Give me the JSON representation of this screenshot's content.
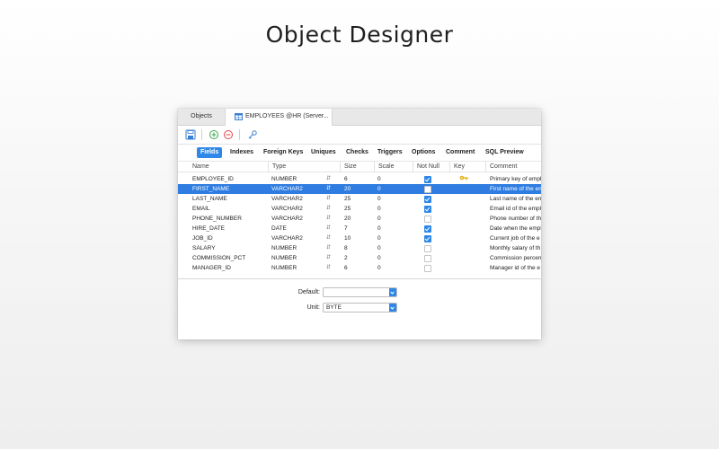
{
  "headline": "Object Designer",
  "tabs": {
    "objects": "Objects",
    "employees": "EMPLOYEES @HR (Server..."
  },
  "subtabs": [
    "Fields",
    "Indexes",
    "Foreign Keys",
    "Uniques",
    "Checks",
    "Triggers",
    "Options",
    "Comment",
    "SQL Preview"
  ],
  "active_subtab": "Fields",
  "columns": [
    "Name",
    "Type",
    "Size",
    "Scale",
    "Not Null",
    "Key",
    "Comment"
  ],
  "rows": [
    {
      "name": "EMPLOYEE_ID",
      "type": "NUMBER",
      "size": "6",
      "scale": "0",
      "not_null": true,
      "key": true,
      "comment": "Primary key of empl"
    },
    {
      "name": "FIRST_NAME",
      "type": "VARCHAR2",
      "size": "20",
      "scale": "0",
      "not_null": false,
      "key": false,
      "comment": "First name of the em"
    },
    {
      "name": "LAST_NAME",
      "type": "VARCHAR2",
      "size": "25",
      "scale": "0",
      "not_null": true,
      "key": false,
      "comment": "Last name of the em"
    },
    {
      "name": "EMAIL",
      "type": "VARCHAR2",
      "size": "25",
      "scale": "0",
      "not_null": true,
      "key": false,
      "comment": "Email id of the empl"
    },
    {
      "name": "PHONE_NUMBER",
      "type": "VARCHAR2",
      "size": "20",
      "scale": "0",
      "not_null": false,
      "key": false,
      "comment": "Phone number of th"
    },
    {
      "name": "HIRE_DATE",
      "type": "DATE",
      "size": "7",
      "scale": "0",
      "not_null": true,
      "key": false,
      "comment": "Date when the empl"
    },
    {
      "name": "JOB_ID",
      "type": "VARCHAR2",
      "size": "10",
      "scale": "0",
      "not_null": true,
      "key": false,
      "comment": "Current job of the e"
    },
    {
      "name": "SALARY",
      "type": "NUMBER",
      "size": "8",
      "scale": "0",
      "not_null": false,
      "key": false,
      "comment": "Monthly salary of th"
    },
    {
      "name": "COMMISSION_PCT",
      "type": "NUMBER",
      "size": "2",
      "scale": "0",
      "not_null": false,
      "key": false,
      "comment": "Commission percen"
    },
    {
      "name": "MANAGER_ID",
      "type": "NUMBER",
      "size": "6",
      "scale": "0",
      "not_null": false,
      "key": false,
      "comment": "Manager id of the e"
    }
  ],
  "selected_row": 1,
  "fields": {
    "default_label": "Default:",
    "default_value": "",
    "unit_label": "Unit:",
    "unit_value": "BYTE"
  },
  "colors": {
    "accent": "#2f88e8",
    "selection": "#2f7de0"
  }
}
